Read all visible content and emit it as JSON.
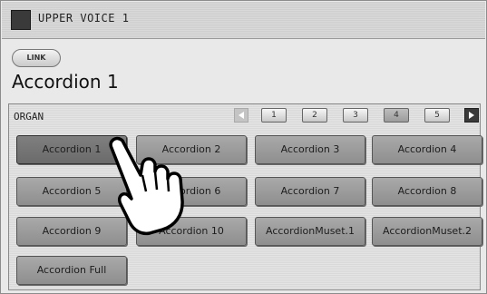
{
  "window": {
    "title": "UPPER VOICE 1"
  },
  "link_button": {
    "label": "LINK"
  },
  "current_voice": "Accordion 1",
  "category": "ORGAN",
  "pages": [
    "1",
    "2",
    "3",
    "4",
    "5"
  ],
  "active_page": "4",
  "voices": [
    "Accordion 1",
    "Accordion 2",
    "Accordion 3",
    "Accordion 4",
    "Accordion 5",
    "Accordion 6",
    "Accordion 7",
    "Accordion 8",
    "Accordion 9",
    "Accordion 10",
    "AccordionMuset.1",
    "AccordionMuset.2",
    "Accordion Full"
  ],
  "selected_voice": "Accordion 1",
  "icons": {
    "prev": "left-arrow-icon",
    "next": "right-arrow-icon",
    "pointer": "hand-pointer-icon"
  }
}
